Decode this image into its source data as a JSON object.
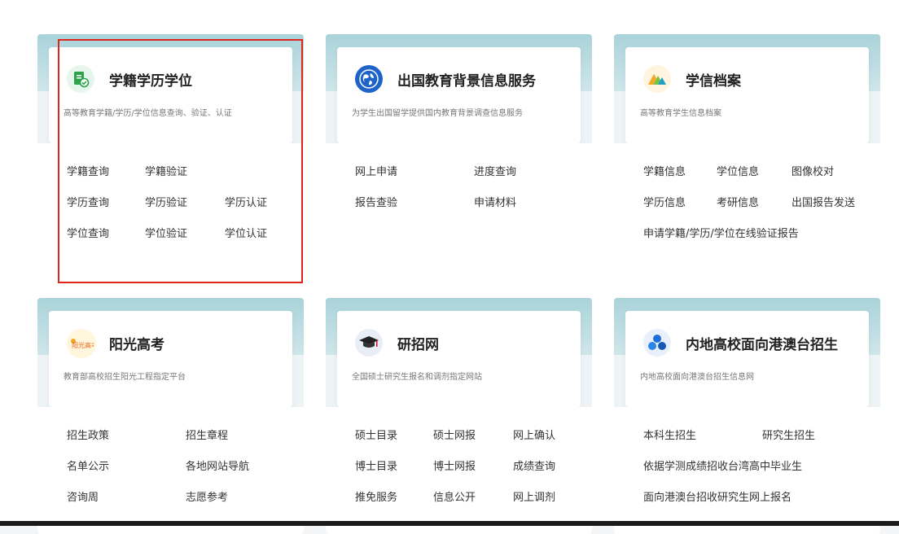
{
  "colors": {
    "highlight": "#e0261c",
    "band": "#a9d3d9",
    "text": "#333333"
  },
  "cards": [
    {
      "title": "学籍学历学位",
      "subtitle": "高等教育学籍/学历/学位信息查询、验证、认证",
      "icon": "document-check-icon",
      "links": [
        "学籍查询",
        "学籍验证",
        "学历查询",
        "学历验证",
        "学历认证",
        "学位查询",
        "学位验证",
        "学位认证"
      ]
    },
    {
      "title": "出国教育背景信息服务",
      "subtitle": "为学生出国留学提供国内教育背景调查信息服务",
      "icon": "globe-icon",
      "links": [
        "网上申请",
        "进度查询",
        "报告查验",
        "申请材料"
      ]
    },
    {
      "title": "学信档案",
      "subtitle": "高等教育学生信息档案",
      "icon": "archive-logo-icon",
      "links": [
        "学籍信息",
        "学位信息",
        "图像校对",
        "学历信息",
        "考研信息",
        "出国报告发送",
        "申请学籍/学历/学位在线验证报告"
      ]
    },
    {
      "title": "阳光高考",
      "subtitle": "教育部高校招生阳光工程指定平台",
      "icon": "sunshine-gaokao-logo-icon",
      "logo_text": "阳光高考",
      "links": [
        "招生政策",
        "招生章程",
        "名单公示",
        "各地网站导航",
        "咨询周",
        "志愿参考"
      ]
    },
    {
      "title": "研招网",
      "subtitle": "全国硕士研究生报名和调剂指定网站",
      "icon": "graduation-cap-icon",
      "links": [
        "硕士目录",
        "硕士网报",
        "网上确认",
        "博士目录",
        "博士网报",
        "成绩查询",
        "推免服务",
        "信息公开",
        "网上调剂"
      ]
    },
    {
      "title": "内地高校面向港澳台招生",
      "subtitle": "内地高校面向港澳台招生信息网",
      "icon": "three-circles-icon",
      "links": [
        "本科生招生",
        "研究生招生",
        "依据学测成绩招收台湾高中毕业生",
        "面向港澳台招收研究生网上报名"
      ]
    }
  ]
}
